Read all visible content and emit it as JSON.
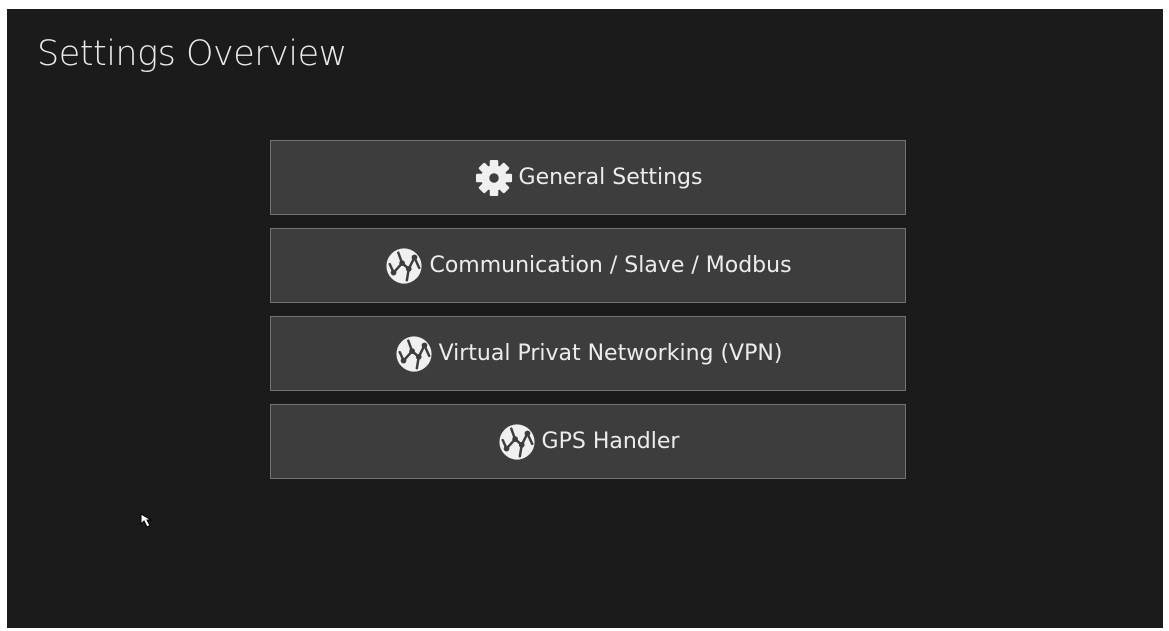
{
  "page": {
    "title": "Settings Overview"
  },
  "menu": {
    "items": [
      {
        "label": "General Settings",
        "icon": "gear-icon"
      },
      {
        "label": "Communication / Slave / Modbus",
        "icon": "network-globe-icon"
      },
      {
        "label": "Virtual Privat Networking (VPN)",
        "icon": "network-globe-icon"
      },
      {
        "label": "GPS Handler",
        "icon": "network-globe-icon"
      }
    ]
  },
  "colors": {
    "background": "#1b1b1b",
    "button_background": "#3d3d3d",
    "button_border": "#727272",
    "text": "#ececec"
  }
}
